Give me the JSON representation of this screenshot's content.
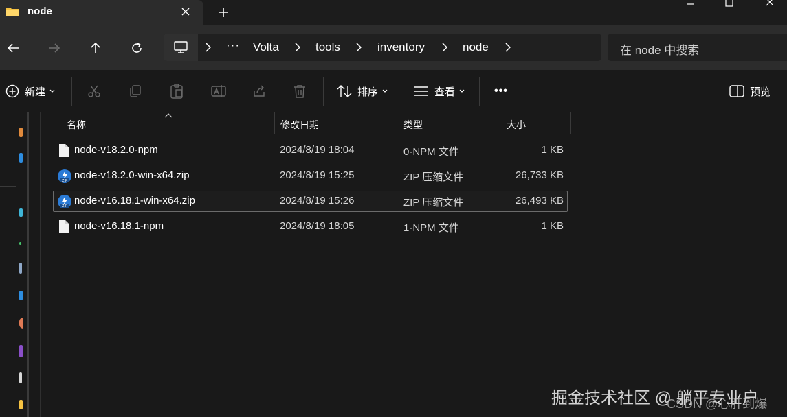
{
  "window": {
    "tab_title": "node",
    "new_tab_symbol": "+",
    "controls": [
      "minimize-icon",
      "maximize-icon",
      "close-icon"
    ]
  },
  "navigation": {
    "back": "back-arrow-icon",
    "forward": "forward-arrow-icon",
    "up": "up-arrow-icon",
    "refresh": "refresh-icon"
  },
  "address_bar": {
    "root_icon": "this-pc-icon",
    "overflow": "···",
    "crumbs": [
      "Volta",
      "tools",
      "inventory",
      "node"
    ]
  },
  "search": {
    "placeholder": "在 node 中搜索"
  },
  "command_bar": {
    "new_label": "新建",
    "sort_label": "排序",
    "view_label": "查看",
    "more_label": "•••",
    "preview_label": "预览",
    "disabled_actions": [
      "cut-icon",
      "copy-icon",
      "paste-icon",
      "rename-icon",
      "share-icon",
      "delete-icon"
    ]
  },
  "file_list": {
    "columns": [
      "名称",
      "修改日期",
      "类型",
      "大小"
    ],
    "rows": [
      {
        "name": "node-v18.2.0-npm",
        "date": "2024/8/19 18:04",
        "type": "0-NPM 文件",
        "size": "1 KB",
        "icon": "file-icon",
        "selected": false
      },
      {
        "name": "node-v18.2.0-win-x64.zip",
        "date": "2024/8/19 15:25",
        "type": "ZIP 压缩文件",
        "size": "26,733 KB",
        "icon": "zip-icon",
        "selected": false
      },
      {
        "name": "node-v16.18.1-win-x64.zip",
        "date": "2024/8/19 15:26",
        "type": "ZIP 压缩文件",
        "size": "26,493 KB",
        "icon": "zip-icon",
        "selected": true
      },
      {
        "name": "node-v16.18.1-npm",
        "date": "2024/8/19 18:05",
        "type": "1-NPM 文件",
        "size": "1 KB",
        "icon": "file-icon",
        "selected": false
      }
    ]
  },
  "watermark": {
    "line1": "掘金技术社区 @ 躺平专业户",
    "line2": "CSDN @心肝到爆"
  },
  "colors": {
    "background": "#191919",
    "chrome": "#2c2c2c",
    "text": "#ffffff",
    "folder_yellow": "#f5c242",
    "zip_blue": "#2b7bd6"
  }
}
